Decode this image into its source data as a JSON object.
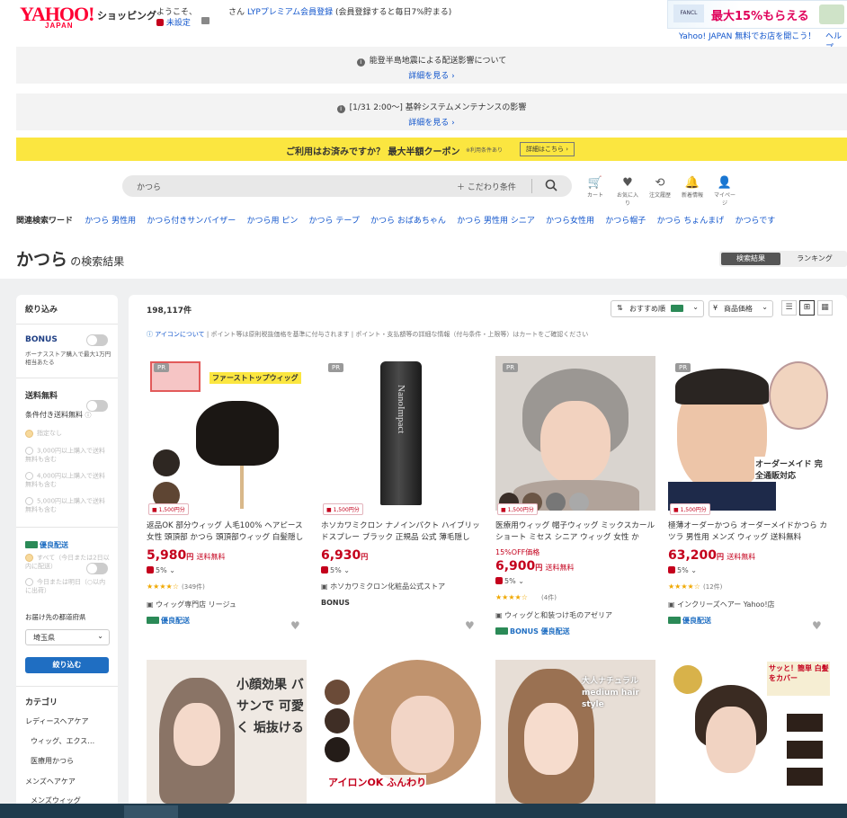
{
  "header": {
    "logo_main": "YAHOO!",
    "logo_sub": "JAPAN",
    "shopping": "ショッピング",
    "welcome": "ようこそ、",
    "unset": "未設定",
    "san": "さん",
    "lyp_link": "LYPプレミアム会員登録",
    "lyp_note": "(会員登録すると毎日7%貯まる)",
    "banner_text": "最大15%もらえる",
    "open_store": "Yahoo! JAPAN 無料でお店を開こう！",
    "help": "ヘルプ"
  },
  "notices": [
    {
      "text": "能登半島地震による配送影響について",
      "link": "詳細を見る"
    },
    {
      "text": "[1/31 2:00〜] 基幹システムメンテナンスの影響",
      "link": "詳細を見る"
    }
  ],
  "coupon": {
    "text": "ご利用はお済みですか？ 最大半額クーポン",
    "note": "※利用条件あり",
    "button": "詳細はこちら"
  },
  "search": {
    "value": "かつら",
    "conditions": "こだわり条件"
  },
  "header_icons": [
    {
      "label": "カート",
      "icon": "cart-icon"
    },
    {
      "label": "お気に入り",
      "icon": "heart-icon"
    },
    {
      "label": "注文履歴",
      "icon": "history-icon"
    },
    {
      "label": "新着情報",
      "icon": "bell-icon"
    },
    {
      "label": "マイページ",
      "icon": "user-icon"
    }
  ],
  "related": {
    "label": "関連検索ワード",
    "words": [
      "かつら 男性用",
      "かつら付きサンバイザー",
      "かつら用 ピン",
      "かつら テープ",
      "かつら おばあちゃん",
      "かつら 男性用 シニア",
      "かつら女性用",
      "かつら帽子",
      "かつら ちょんまげ",
      "かつらです"
    ]
  },
  "results": {
    "keyword": "かつら",
    "suffix": "の検索結果",
    "tab_results": "検索結果",
    "tab_ranking": "ランキング",
    "count": "198,117件",
    "sort": "おすすめ順",
    "price_sort": "商品価格",
    "icon_link": "アイコンについて",
    "disclaimer": "| ポイント等は原則税抜価格を基準に付与されます | ポイント・支払額等の詳細な情報（付与条件・上限等）はカートをご確認ください"
  },
  "sidebar": {
    "title": "絞り込み",
    "bonus_label": "BONUS",
    "bonus_desc": "ボーナスストア購入で最大1万円相当あたる",
    "free_ship": "送料無料",
    "cond_free": "条件付き送料無料",
    "options": [
      "指定なし",
      "3,000円以上購入で送料無料も含む",
      "4,000円以上購入で送料無料も含む",
      "5,000円以上購入で送料無料も含む"
    ],
    "yuryo": "優良配送",
    "yuryo_options": [
      "すべて（今日または2日以内に配送）",
      "今日または明日（○以内に出荷）"
    ],
    "pref_label": "お届け先の都道府県",
    "pref_value": "埼玉県",
    "apply": "絞り込む",
    "category": "カテゴリ",
    "cats": [
      "レディースヘアケア",
      "ウィッグ、エクス…",
      "医療用かつら",
      "メンズヘアケア",
      "メンズウィッグ"
    ]
  },
  "products": [
    {
      "pr": "PR",
      "tag": "1,500円分",
      "title": "返品OK 部分ウィッグ 人毛100% ヘアピース 女性 頭頂部 かつら 頭頂部ウィッグ 白髪隠し",
      "price": "5,980",
      "yen": "円",
      "ship": "送料無料",
      "points": "5%",
      "rating": "★★★★☆",
      "reviews": "(349件)",
      "store": "ウィッグ専門店 リージュ",
      "badge": "優良配送",
      "img_label": "ファーストトップウィッグ"
    },
    {
      "pr": "PR",
      "tag": "1,500円分",
      "title": "ホソカワミクロン ナノインパクト ハイブリッドスプレー ブラック 正規品 公式 薄毛隠し",
      "price": "6,930",
      "yen": "円",
      "ship": "",
      "points": "5%",
      "rating": "",
      "reviews": "",
      "store": "ホソカワミクロン化粧品公式ストア",
      "badge": "BONUS",
      "img_label": "NanoImpact"
    },
    {
      "pr": "PR",
      "tag": "1,500円分",
      "title": "医療用ウィッグ 帽子ウィッグ ミックスカールショート ミセス シニア ウィッグ 女性 か",
      "discount": "15%OFF価格",
      "price": "6,900",
      "yen": "円",
      "ship": "送料無料",
      "points": "5%",
      "rating": "★★★★☆",
      "reviews": "(4件)",
      "store": "ウィッグと和装つけ毛のアゼリア",
      "badge": "BONUS 優良配送",
      "img_label": ""
    },
    {
      "pr": "PR",
      "tag": "1,500円分",
      "title": "極薄オーダーかつら オーダーメイドかつら カツラ 男性用 メンズ ウィッグ 送料無料",
      "price": "63,200",
      "yen": "円",
      "ship": "送料無料",
      "points": "5%",
      "rating": "★★★★☆",
      "reviews": "(12件)",
      "store": "インクリーズヘアー Yahoo!店",
      "badge": "優良配送",
      "img_label": "オーダーメイド 完全通販対応"
    }
  ],
  "row2": [
    {
      "img_label": "小顔効果 バサンで 可愛く 垢抜ける"
    },
    {
      "img_label": "アイロンOK ふんわり"
    },
    {
      "img_label": "大人ナチュラル medium hair style"
    },
    {
      "img_label": "サッと！簡単 白髪をカバー"
    }
  ]
}
